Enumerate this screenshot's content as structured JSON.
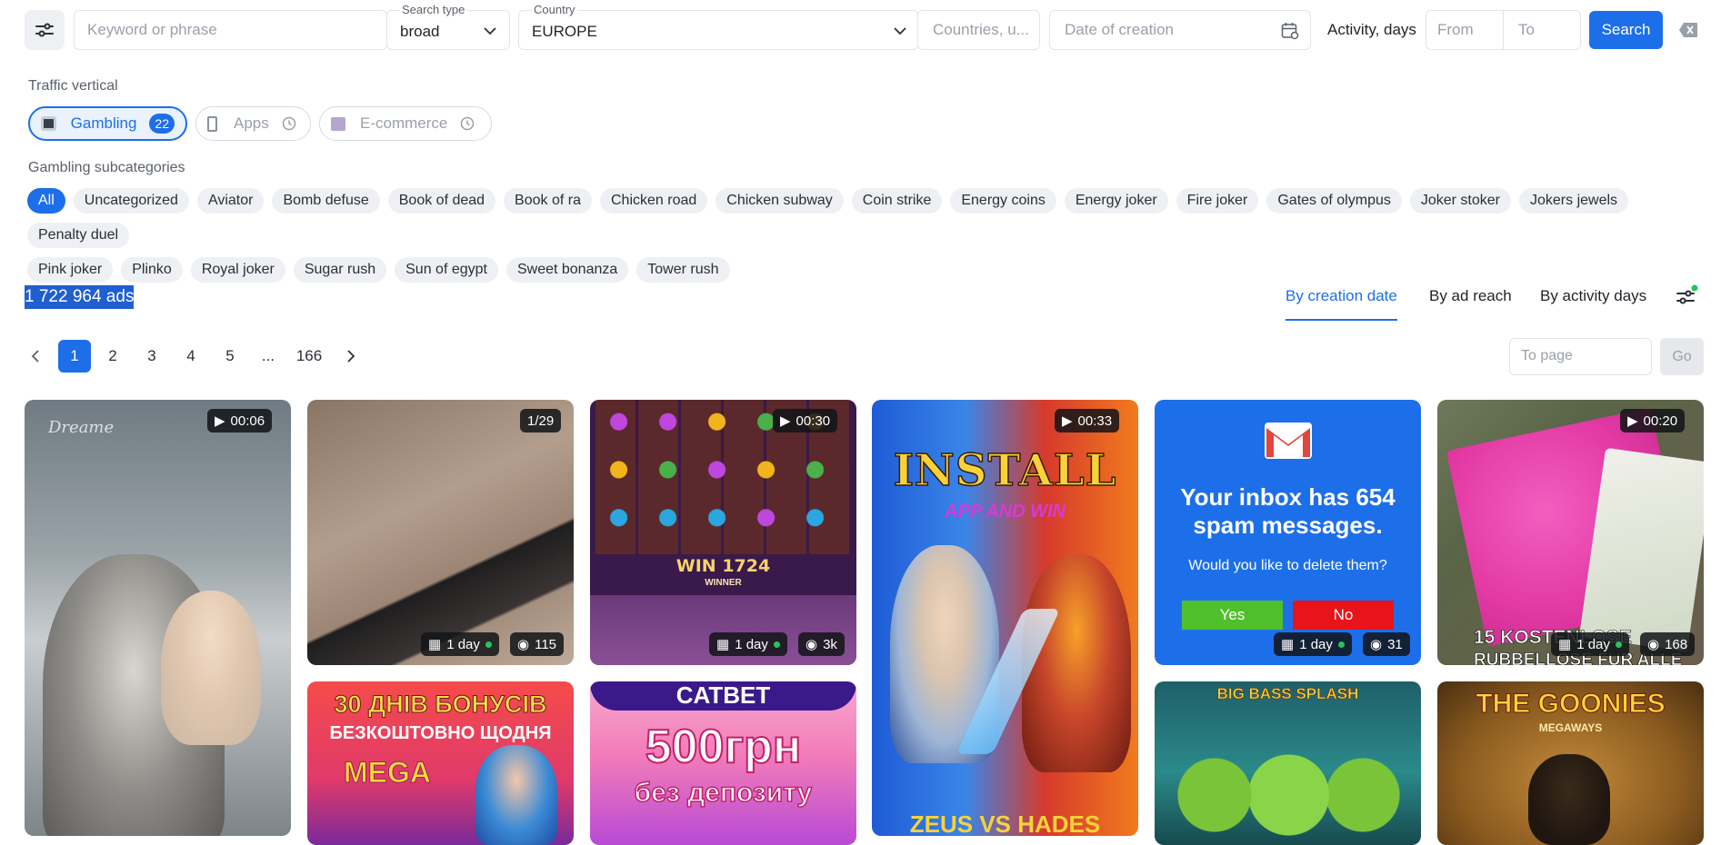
{
  "search": {
    "keyword_placeholder": "Keyword or phrase",
    "search_type_label": "Search type",
    "search_type_value": "broad",
    "country_label": "Country",
    "country_value": "EUROPE",
    "countries_placeholder": "Countries, u...",
    "date_placeholder": "Date of creation",
    "activity_label": "Activity, days",
    "from_placeholder": "From",
    "to_placeholder": "To",
    "search_button": "Search"
  },
  "vertical": {
    "heading": "Traffic vertical",
    "items": [
      {
        "label": "Gambling",
        "count": "22"
      },
      {
        "label": "Apps"
      },
      {
        "label": "E-commerce"
      }
    ]
  },
  "subcategories": {
    "heading": "Gambling subcategories",
    "chips": [
      "All",
      "Uncategorized",
      "Aviator",
      "Bomb defuse",
      "Book of dead",
      "Book of ra",
      "Chicken road",
      "Chicken subway",
      "Coin strike",
      "Energy coins",
      "Energy joker",
      "Fire joker",
      "Gates of olympus",
      "Joker stoker",
      "Jokers jewels",
      "Penalty duel",
      "Pink joker",
      "Plinko",
      "Royal joker",
      "Sugar rush",
      "Sun of egypt",
      "Sweet bonanza",
      "Tower rush"
    ]
  },
  "results": {
    "count": "1 722 964 ads",
    "sort_options": [
      "By creation date",
      "By ad reach",
      "By activity days"
    ]
  },
  "pagination": {
    "pages": [
      "1",
      "2",
      "3",
      "4",
      "5",
      "...",
      "166"
    ],
    "to_page_placeholder": "To page",
    "go_button": "Go"
  },
  "cards": [
    {
      "badge": "00:06",
      "watermark": "Dreame"
    },
    {
      "badge": "1/29",
      "days": "1 day",
      "views": "115"
    },
    {
      "badge": "00:30",
      "days": "1 day",
      "views": "3k",
      "text_main": "WIN 1724",
      "text_sub": "WINNER"
    },
    {
      "badge": "00:33",
      "title": "INSTALL",
      "subtitle": "APP AND WIN",
      "bottom": "ZEUS VS HADES"
    },
    {
      "headline": "Your inbox has 654 spam messages.",
      "question": "Would you like to delete them?",
      "yes": "Yes",
      "no": "No",
      "days": "1 day",
      "views": "31"
    },
    {
      "badge": "00:20",
      "days": "1 day",
      "views": "168",
      "caption": "15 KOSTENLOSE",
      "caption2": "RUBBELLOSE FÜR ALLE"
    },
    {
      "line1": "30 ДНІВ БОНУСІВ",
      "line2": "БЕЗКОШТОВНО ЩОДНЯ",
      "brand": "MEGA"
    },
    {
      "brand": "CATBET",
      "big": "500грн",
      "sub": "без депозиту"
    },
    {
      "brand": "BIG BASS SPLASH"
    },
    {
      "brand": "THE GOONIES",
      "sub": "MEGAWAYS"
    }
  ],
  "colors": {
    "accent": "#1d6fe9",
    "active_dot": "#22c55e"
  }
}
